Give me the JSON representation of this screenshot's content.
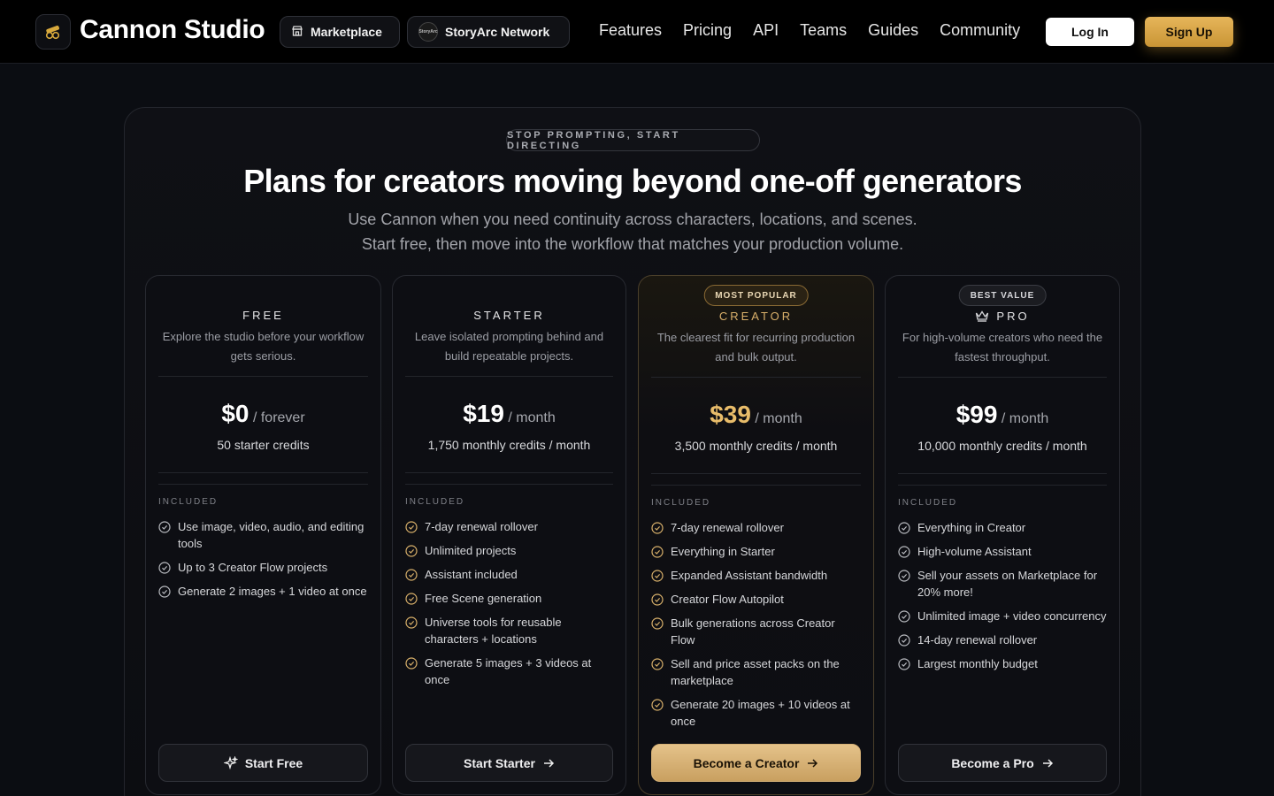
{
  "header": {
    "brand": "Cannon Studio",
    "marketplace_label": "Marketplace",
    "storyarc_label": "StoryArc Network",
    "storyarc_badge": "StoryArc",
    "nav": [
      "Features",
      "Pricing",
      "API",
      "Teams",
      "Guides",
      "Community"
    ],
    "login_label": "Log In",
    "signup_label": "Sign Up"
  },
  "hero": {
    "eyebrow": "STOP PROMPTING, START DIRECTING",
    "title": "Plans for creators moving beyond one-off generators",
    "subtitle_line1": "Use Cannon when you need continuity across characters, locations, and scenes.",
    "subtitle_line2": "Start free, then move into the workflow that matches your production volume."
  },
  "plans": [
    {
      "name": "FREE",
      "description": "Explore the studio before your workflow gets serious.",
      "amount": "$0",
      "period": "/ forever",
      "credits": "50 starter credits",
      "included_label": "INCLUDED",
      "features": [
        "Use image, video, audio, and editing tools",
        "Up to 3 Creator Flow projects",
        "Generate 2 images + 1 video at once"
      ],
      "cta": "Start Free"
    },
    {
      "name": "STARTER",
      "description": "Leave isolated prompting behind and build repeatable projects.",
      "amount": "$19",
      "period": "/ month",
      "credits": "1,750 monthly credits / month",
      "included_label": "INCLUDED",
      "features": [
        "7-day renewal rollover",
        "Unlimited projects",
        "Assistant included",
        "Free Scene generation",
        "Universe tools for reusable characters + locations",
        "Generate 5 images + 3 videos at once"
      ],
      "cta": "Start Starter"
    },
    {
      "badge": "MOST POPULAR",
      "name": "CREATOR",
      "description": "The clearest fit for recurring production and bulk output.",
      "amount": "$39",
      "period": "/ month",
      "credits": "3,500 monthly credits / month",
      "included_label": "INCLUDED",
      "features": [
        "7-day renewal rollover",
        "Everything in Starter",
        "Expanded Assistant bandwidth",
        "Creator Flow Autopilot",
        "Bulk generations across Creator Flow",
        "Sell and price asset packs on the marketplace",
        "Generate 20 images + 10 videos at once"
      ],
      "cta": "Become a Creator"
    },
    {
      "badge": "BEST VALUE",
      "name": "PRO",
      "description": "For high-volume creators who need the fastest throughput.",
      "amount": "$99",
      "period": "/ month",
      "credits": "10,000 monthly credits / month",
      "included_label": "INCLUDED",
      "features": [
        "Everything in Creator",
        "High-volume Assistant",
        "Sell your assets on Marketplace for 20% more!",
        "Unlimited image + video concurrency",
        "14-day renewal rollover",
        "Largest monthly budget"
      ],
      "cta": "Become a Pro"
    }
  ],
  "colors": {
    "accent_gold": "#e6b55a",
    "background": "#0b0d12"
  }
}
